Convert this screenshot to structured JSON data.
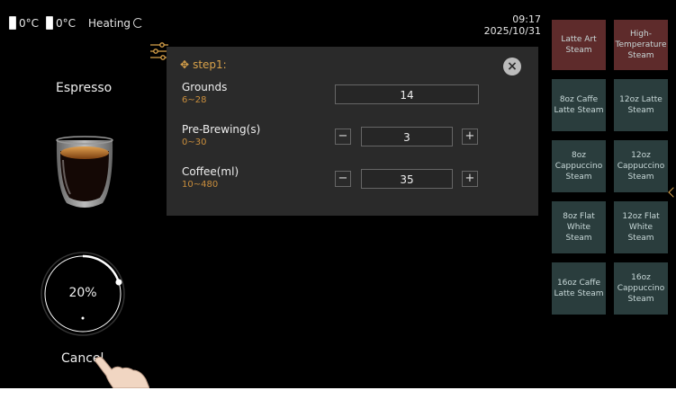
{
  "status": {
    "temp1": "0°C",
    "temp2": "0°C",
    "heating": "Heating"
  },
  "clock": {
    "time": "09:17",
    "date": "2025/10/31"
  },
  "drink": {
    "name": "Espresso"
  },
  "progress": {
    "label": "20%",
    "value": 0.2
  },
  "cancel_label": "Cancel",
  "panel": {
    "step": "step1:",
    "params": [
      {
        "name": "Grounds",
        "range": "6~28",
        "value": "14"
      },
      {
        "name": "Pre-Brewing(s)",
        "range": "0~30",
        "value": "3"
      },
      {
        "name": "Coffee(ml)",
        "range": "10~480",
        "value": "35"
      }
    ],
    "minus": "−",
    "plus": "+"
  },
  "tiles": [
    {
      "label": "Latte Art Steam",
      "color": "#5e2b2b"
    },
    {
      "label": "High-Temperature Steam",
      "color": "#5e2b2b"
    },
    {
      "label": "8oz Caffe Latte Steam",
      "color": "#2a3d3d"
    },
    {
      "label": "12oz Latte Steam",
      "color": "#2a3d3d"
    },
    {
      "label": "8oz Cappuccino Steam",
      "color": "#2a3d3d"
    },
    {
      "label": "12oz Cappuccino Steam",
      "color": "#2a3d3d"
    },
    {
      "label": "8oz Flat White Steam",
      "color": "#2a3d3d"
    },
    {
      "label": "12oz Flat White Steam",
      "color": "#2a3d3d"
    },
    {
      "label": "16oz Caffe Latte Steam",
      "color": "#2a3d3d"
    },
    {
      "label": "16oz Cappuccino Steam",
      "color": "#2a3d3d"
    }
  ],
  "colors": {
    "accent": "#d9a24a",
    "range_text": "#c88d3c",
    "panel_bg": "#2a2a2a"
  }
}
